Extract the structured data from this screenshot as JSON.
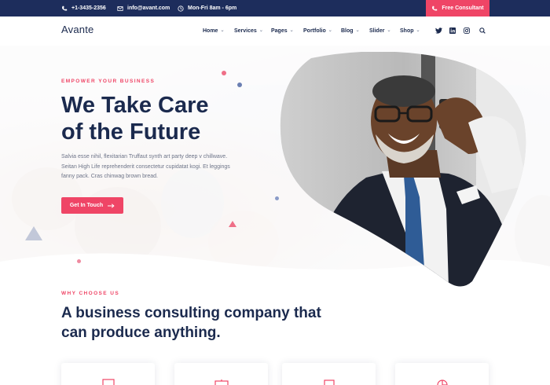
{
  "topbar": {
    "phone": "+1-3435-2356",
    "email": "info@avant.com",
    "hours": "Mon-Fri 8am - 6pm",
    "cta_label": "Free Consultant"
  },
  "brand": {
    "logo_text": "Avante"
  },
  "nav": {
    "items": [
      {
        "label": "Home"
      },
      {
        "label": "Services"
      },
      {
        "label": "Pages"
      },
      {
        "label": "Portfolio"
      },
      {
        "label": "Blog"
      },
      {
        "label": "Slider"
      },
      {
        "label": "Shop"
      }
    ],
    "social": [
      "twitter-icon",
      "linkedin-icon",
      "instagram-icon"
    ],
    "search_icon": "search-icon"
  },
  "hero": {
    "eyebrow": "EMPOWER YOUR BUSINESS",
    "title_line1": "We Take Care",
    "title_line2": "of the Future",
    "text": "Salvia esse nihil, flexitarian Truffaut synth art party deep v chillwave. Seitan High Life reprehenderit consectetur cupidatat kogi. Et leggings fanny pack. Cras chinwag brown bread.",
    "button_label": "Get In Touch",
    "button_icon": "arrow-right-icon"
  },
  "why": {
    "eyebrow": "WHY CHOOSE US",
    "title_line1": "A business consulting company that",
    "title_line2": "can produce anything."
  },
  "cards": [
    {
      "icon": "monitor-icon"
    },
    {
      "icon": "presentation-icon"
    },
    {
      "icon": "laptop-icon"
    },
    {
      "icon": "chart-pie-icon"
    }
  ],
  "colors": {
    "navy": "#1d2d5c",
    "accent": "#ef4566",
    "text": "#1b2a4e",
    "muted": "#6d7488"
  }
}
